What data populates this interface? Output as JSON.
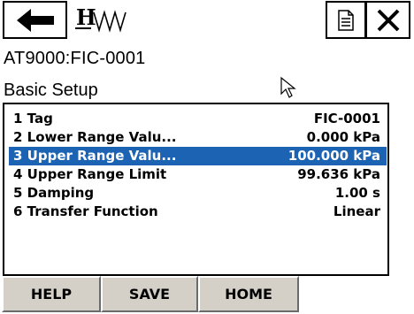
{
  "toolbar": {
    "back_icon": "left-arrow-icon",
    "logo_icon": "hart-logo-icon",
    "doc_icon": "document-icon",
    "close_icon": "close-x-icon"
  },
  "device_name": "AT9000:FIC-0001",
  "menu_title": "Basic Setup",
  "rows": [
    {
      "label": "1 Tag",
      "value": "FIC-0001"
    },
    {
      "label": "2 Lower Range Valu...",
      "value": "0.000 kPa"
    },
    {
      "label": "3 Upper Range Valu...",
      "value": "100.000 kPa"
    },
    {
      "label": "4 Upper Range Limit",
      "value": "99.636 kPa"
    },
    {
      "label": "5 Damping",
      "value": "1.00 s"
    },
    {
      "label": "6 Transfer Function",
      "value": "Linear"
    }
  ],
  "selected_row_label": "3 Upper Range Valu...",
  "buttons": {
    "help": "HELP",
    "save": "SAVE",
    "home": "HOME"
  },
  "colors": {
    "selection": "#1c63b4",
    "button_face": "#d4d0c8"
  }
}
